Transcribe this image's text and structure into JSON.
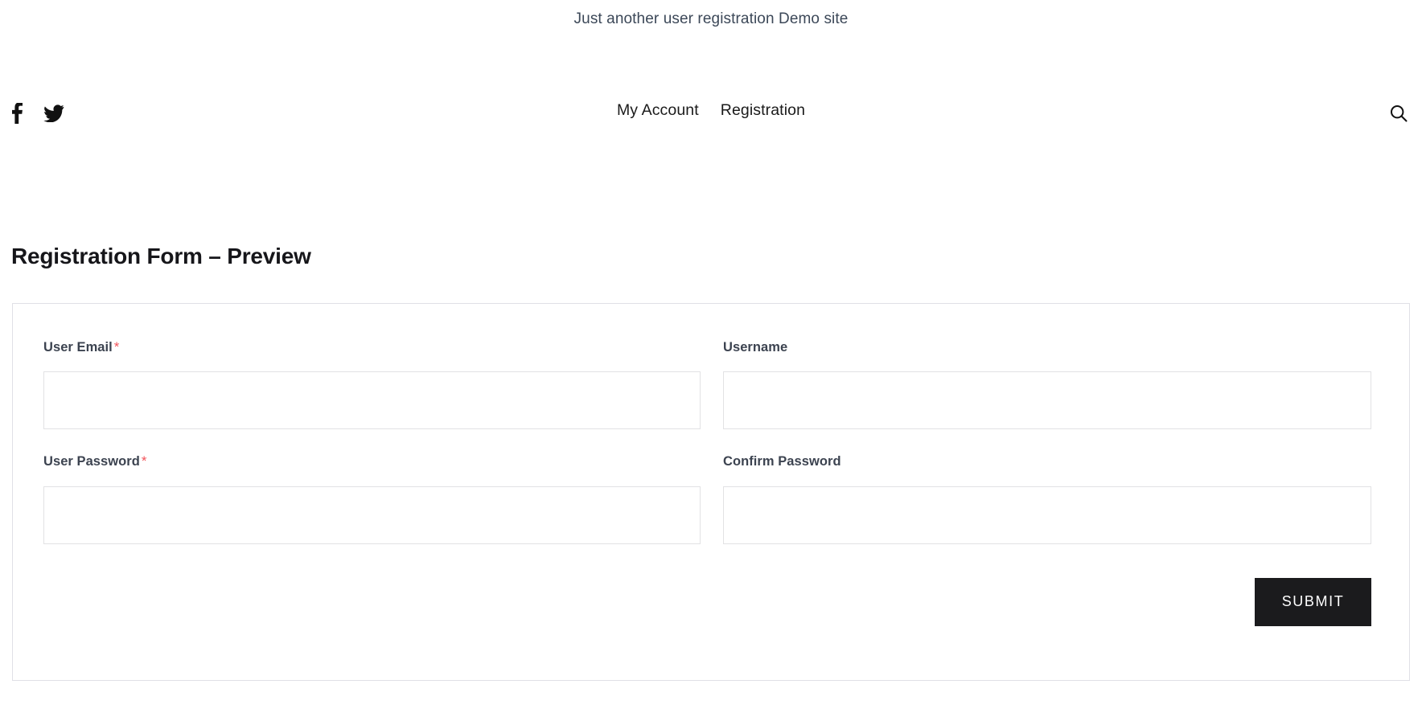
{
  "site": {
    "tagline": "Just another user registration Demo site"
  },
  "header": {
    "social": [
      {
        "name": "facebook-icon",
        "label": "Facebook"
      },
      {
        "name": "twitter-icon",
        "label": "Twitter"
      }
    ],
    "nav": [
      {
        "label": "My Account"
      },
      {
        "label": "Registration"
      }
    ],
    "search_icon": "search-icon"
  },
  "form": {
    "title": "Registration Form – Preview",
    "fields": [
      {
        "label": "User Email",
        "required": true,
        "required_mark": "*",
        "value": "",
        "placeholder": "",
        "type": "email"
      },
      {
        "label": "Username",
        "required": false,
        "required_mark": "",
        "value": "",
        "placeholder": "",
        "type": "text"
      },
      {
        "label": "User Password",
        "required": true,
        "required_mark": "*",
        "value": "",
        "placeholder": "",
        "type": "password"
      },
      {
        "label": "Confirm Password",
        "required": false,
        "required_mark": "",
        "value": "",
        "placeholder": "",
        "type": "password"
      }
    ],
    "submit_label": "Submit"
  },
  "colors": {
    "required_star": "#f2545b",
    "submit_bg": "#1b1b1d",
    "label_text": "#3c4350",
    "border": "#e2e2e4"
  }
}
